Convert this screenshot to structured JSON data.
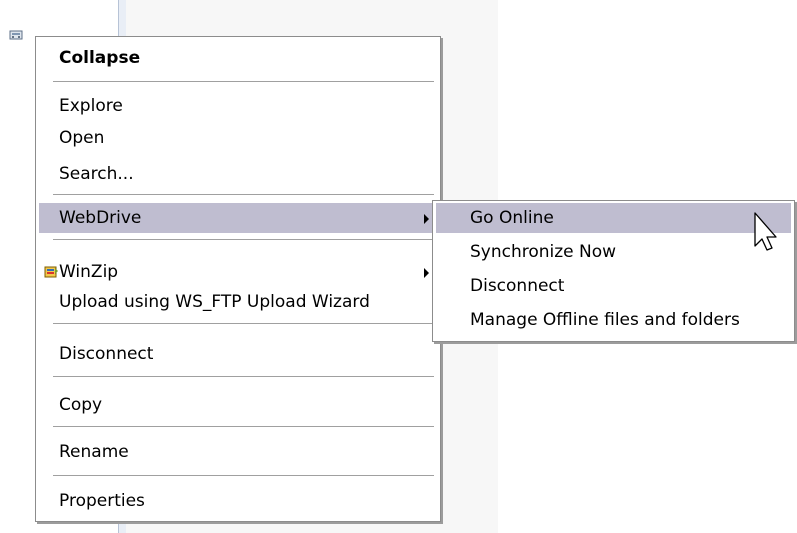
{
  "context_menu": {
    "collapse": "Collapse",
    "explore": "Explore",
    "open": "Open",
    "search": "Search...",
    "webdrive": "WebDrive",
    "winzip": "WinZip",
    "upload": "Upload using WS_FTP Upload Wizard",
    "disconnect": "Disconnect",
    "copy": "Copy",
    "rename": "Rename",
    "properties": "Properties"
  },
  "webdrive_submenu": {
    "go_online": "Go Online",
    "synchronize_now": "Synchronize Now",
    "disconnect": "Disconnect",
    "manage_offline": "Manage Offline files and folders"
  },
  "colors": {
    "highlight": "#bfbdd0",
    "menu_border": "#8c8c8c",
    "separator": "#a0a0a0"
  },
  "icons": {
    "tree_node": "network-drive-icon",
    "winzip": "winzip-icon",
    "cursor": "arrow-cursor-icon"
  }
}
